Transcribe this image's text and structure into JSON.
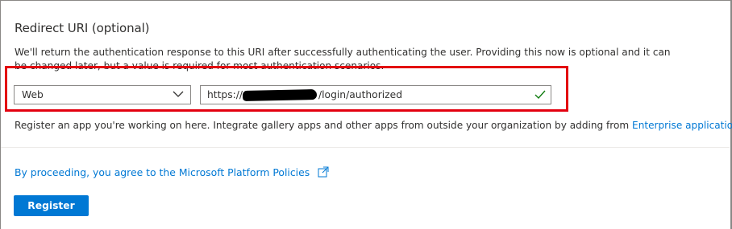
{
  "redirect": {
    "title": "Redirect URI (optional)",
    "description": "We'll return the authentication response to this URI after successfully authenticating the user. Providing this now is optional and it can be changed later, but a value is required for most authentication scenarios.",
    "platform_value": "Web",
    "uri_prefix": "https://",
    "uri_suffix": "/login/authorized",
    "help_text": "Register an app you're working on here. Integrate gallery apps and other apps from outside your organization by adding from ",
    "help_link": "Enterprise applications",
    "accent_color": "#0078d4",
    "valid_color": "#107c10",
    "highlight_color": "#e3000f"
  },
  "footer": {
    "policy_text": "By proceeding, you agree to the Microsoft Platform Policies",
    "register_label": "Register",
    "icons": [
      "chevron-down-icon",
      "checkmark-icon",
      "external-link-icon"
    ]
  }
}
